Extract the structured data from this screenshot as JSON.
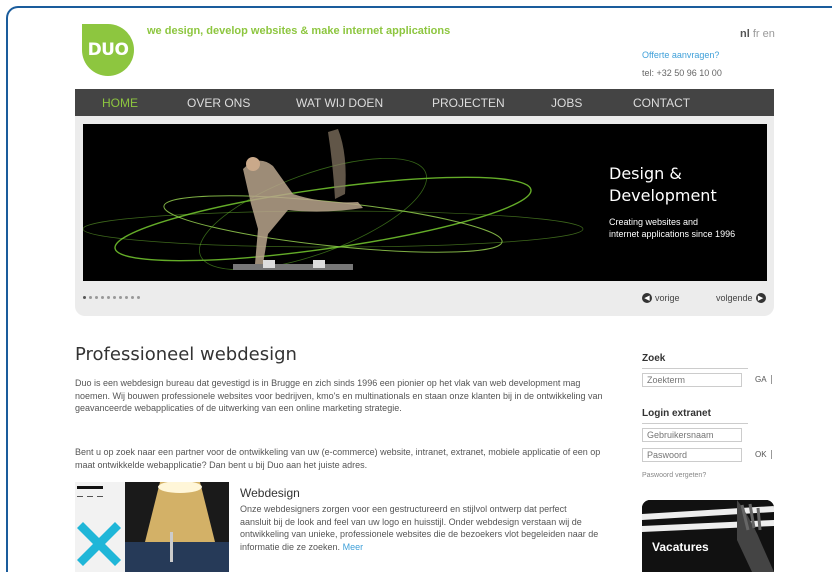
{
  "brand": {
    "logo_text": "DUO",
    "tagline": "we design, develop websites & make internet applications"
  },
  "languages": [
    {
      "code": "nl",
      "active": true
    },
    {
      "code": "fr",
      "active": false
    },
    {
      "code": "en",
      "active": false
    }
  ],
  "header": {
    "offerte": "Offerte aanvragen?",
    "tel": "tel: +32 50 96 10 00"
  },
  "nav": [
    {
      "label": "HOME",
      "active": true
    },
    {
      "label": "OVER ONS",
      "active": false
    },
    {
      "label": "WAT WIJ DOEN",
      "active": false
    },
    {
      "label": "PROJECTEN",
      "active": false
    },
    {
      "label": "JOBS",
      "active": false
    },
    {
      "label": "CONTACT",
      "active": false
    }
  ],
  "hero": {
    "title_line1": "Design &",
    "title_line2": "Development",
    "sub_line1": "Creating websites and",
    "sub_line2": "internet applications since 1996"
  },
  "slider": {
    "slide_count": 10,
    "active_slide": 1,
    "prev": "vorige",
    "next": "volgende"
  },
  "main": {
    "title": "Professioneel webdesign",
    "p1": "Duo is een webdesign bureau dat gevestigd is in Brugge en zich sinds 1996 een pionier op het vlak van web development mag noemen. Wij bouwen professionele websites voor bedrijven, kmo's en multinationals en staan onze klanten bij in de ontwikkeling van geavanceerde webapplicaties of de uitwerking van een online marketing strategie.",
    "p2": "Bent u op zoek naar een partner voor de ontwikkeling van uw (e-commerce) website, intranet, extranet, mobiele applicatie of een op maat ontwikkelde webapplicatie? Dan bent u bij Duo aan het juiste adres.",
    "webdesign_title": "Webdesign",
    "webdesign_text": "Onze webdesigners zorgen voor een gestructureerd en stijlvol ontwerp dat perfect aansluit bij de look and feel van uw logo en huisstijl. Onder webdesign verstaan wij de ontwikkeling van unieke, professionele websites die de bezoekers vlot begeleiden naar de informatie die ze zoeken.",
    "webdesign_more": "Meer"
  },
  "sidebar": {
    "search_title": "Zoek",
    "search_placeholder": "Zoekterm",
    "search_button": "GA",
    "login_title": "Login extranet",
    "username_placeholder": "Gebruikersnaam",
    "password_placeholder": "Paswoord",
    "login_button": "OK",
    "forgot": "Paswoord vergeten?",
    "vacatures": "Vacatures"
  },
  "colors": {
    "brand_green": "#8dc63f",
    "nav_bg": "#444444",
    "link_blue": "#3fa0d9",
    "frame_blue": "#1a5c9c"
  }
}
